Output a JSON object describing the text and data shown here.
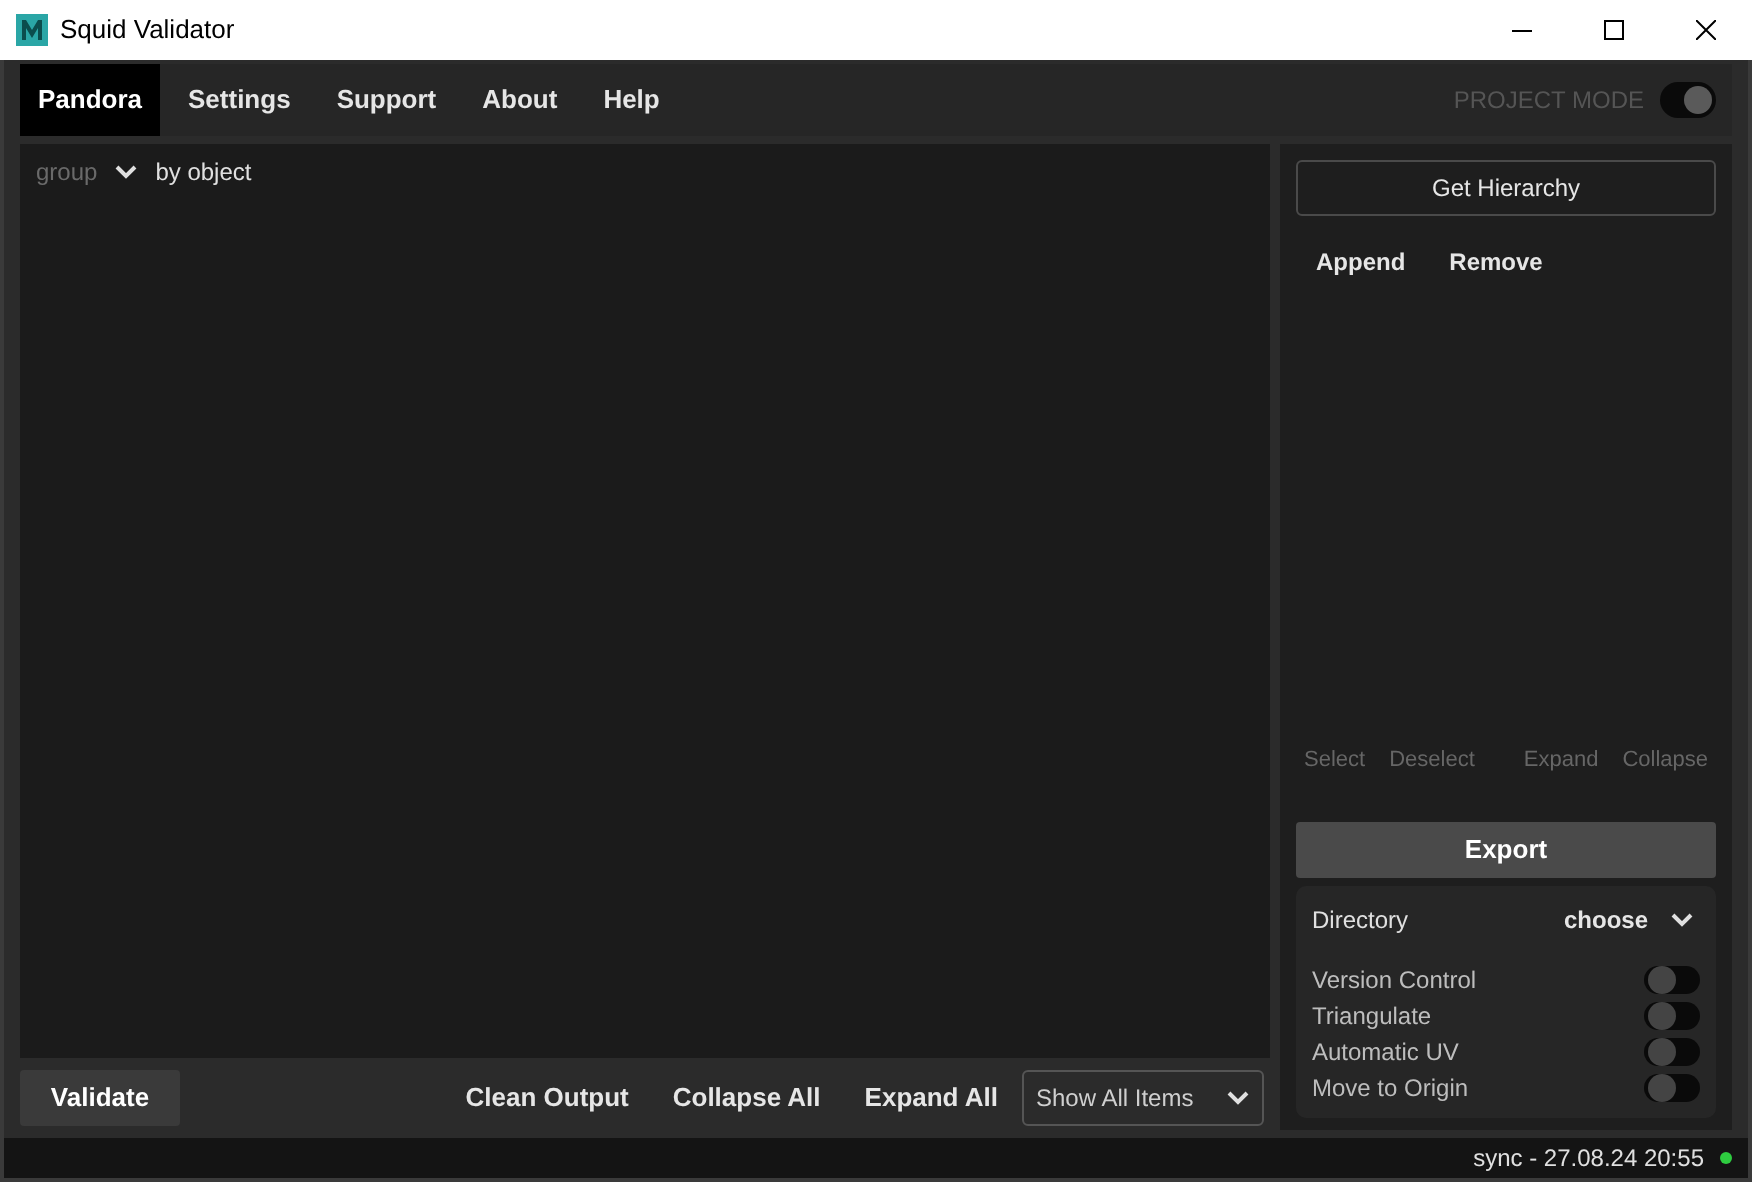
{
  "window": {
    "title": "Squid Validator"
  },
  "tabs": [
    {
      "label": "Pandora",
      "selected": true
    },
    {
      "label": "Settings",
      "selected": false
    },
    {
      "label": "Support",
      "selected": false
    },
    {
      "label": "About",
      "selected": false
    },
    {
      "label": "Help",
      "selected": false
    }
  ],
  "project_mode": {
    "label": "PROJECT MODE",
    "on": true
  },
  "output": {
    "group_label": "group",
    "group_value": "by object"
  },
  "hierarchy": {
    "get_button": "Get Hierarchy",
    "actions": [
      "Append",
      "Remove"
    ],
    "tree_actions": [
      "Select",
      "Deselect",
      "Expand",
      "Collapse"
    ]
  },
  "export": {
    "button": "Export",
    "directory_label": "Directory",
    "directory_value": "choose",
    "options": [
      {
        "label": "Version Control",
        "on": false
      },
      {
        "label": "Triangulate",
        "on": false
      },
      {
        "label": "Automatic UV",
        "on": false
      },
      {
        "label": "Move to Origin",
        "on": false
      }
    ]
  },
  "bottom_bar": {
    "validate": "Validate",
    "actions": [
      "Clean Output",
      "Collapse All",
      "Expand All"
    ],
    "filter": "Show All Items"
  },
  "status_bar": {
    "text": "sync - 27.08.24 20:55",
    "connected": true
  }
}
